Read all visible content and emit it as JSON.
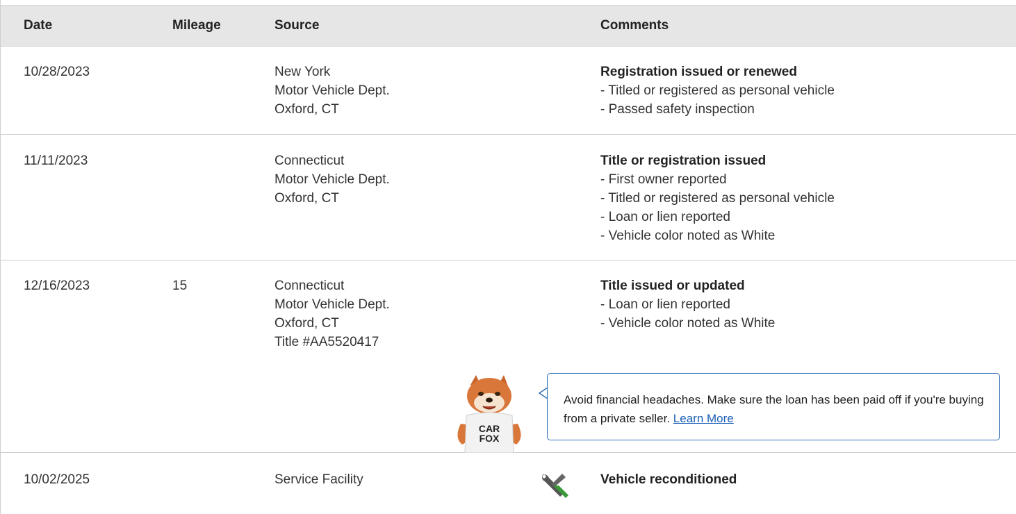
{
  "columns": {
    "date": "Date",
    "mileage": "Mileage",
    "source": "Source",
    "comments": "Comments"
  },
  "rows": [
    {
      "date": "10/28/2023",
      "mileage": "",
      "source": [
        "New York",
        "Motor Vehicle Dept.",
        "Oxford, CT"
      ],
      "comment_title": "Registration issued or renewed",
      "comment_items": [
        "- Titled or registered as personal vehicle",
        "- Passed safety inspection"
      ]
    },
    {
      "date": "11/11/2023",
      "mileage": "",
      "source": [
        "Connecticut",
        "Motor Vehicle Dept.",
        "Oxford, CT"
      ],
      "comment_title": "Title or registration issued",
      "comment_items": [
        "- First owner reported",
        "- Titled or registered as personal vehicle",
        "- Loan or lien reported",
        "- Vehicle color noted as White"
      ]
    },
    {
      "date": "12/16/2023",
      "mileage": "15",
      "source": [
        "Connecticut",
        "Motor Vehicle Dept.",
        "Oxford, CT",
        "Title #AA5520417"
      ],
      "comment_title": "Title issued or updated",
      "comment_items": [
        "- Loan or lien reported",
        "- Vehicle color noted as White"
      ]
    },
    {
      "date": "10/02/2025",
      "mileage": "",
      "source": [
        "Service Facility"
      ],
      "comment_title": "Vehicle reconditioned",
      "comment_items": []
    }
  ],
  "tip": {
    "text": "Avoid financial headaches. Make sure the loan has been paid off if you're buying from a private seller.",
    "link_label": "Learn More"
  },
  "mascot": {
    "shirt_line1": "CAR",
    "shirt_line2": "FOX"
  },
  "icons": {
    "service": "wrench-screwdriver-icon",
    "mascot": "carfox-mascot"
  },
  "colors": {
    "header_bg": "#e6e6e6",
    "tip_border": "#2f6db5",
    "link": "#1a5fb4",
    "wrench_green": "#3a9a3a"
  }
}
